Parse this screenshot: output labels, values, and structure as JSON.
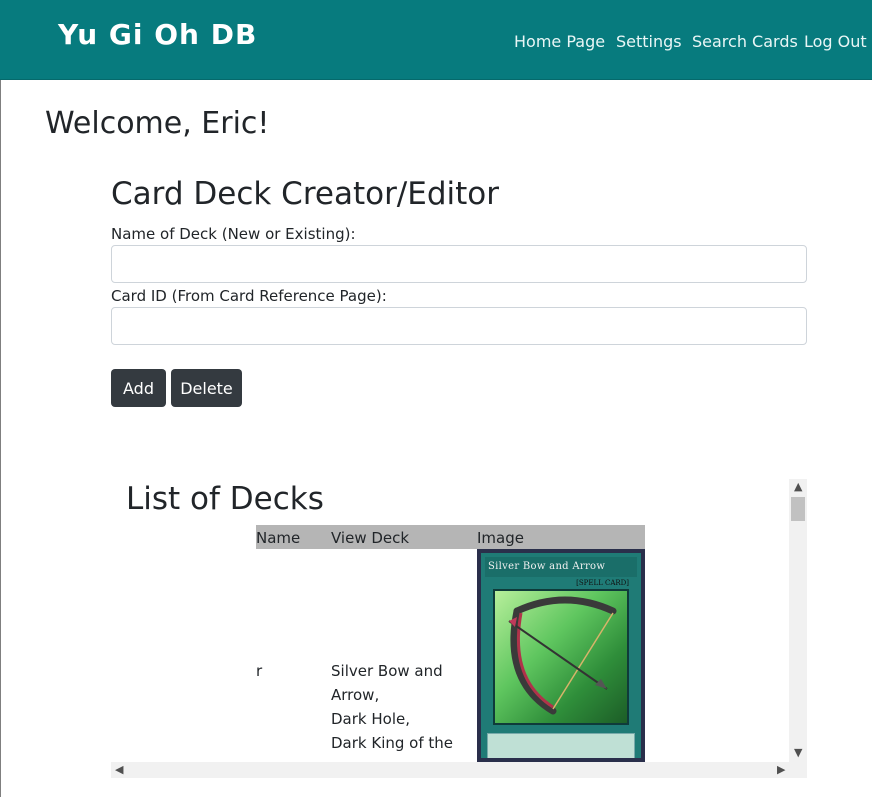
{
  "navbar": {
    "brand": "Yu Gi Oh DB",
    "links": [
      "Home Page",
      "Settings",
      "Search Cards",
      "Log Out"
    ]
  },
  "welcome": "Welcome, Eric!",
  "form": {
    "title": "Card Deck Creator/Editor",
    "deck_name_label": "Name of Deck (New or Existing):",
    "deck_name_value": "",
    "card_id_label": "Card ID (From Card Reference Page):",
    "card_id_value": "",
    "add_label": "Add",
    "delete_label": "Delete"
  },
  "decks": {
    "title": "List of Decks",
    "columns": [
      "Name",
      "View Deck",
      "Image"
    ],
    "rows": [
      {
        "name": "r",
        "cards": [
          "Silver Bow and",
          "Arrow,",
          "Dark Hole,",
          "Dark King of the"
        ],
        "image": {
          "title": "Silver Bow and Arrow",
          "type_line": "[SPELL CARD]"
        }
      }
    ]
  },
  "colors": {
    "navbar": "#077b7e",
    "button": "#343a40",
    "table_header": "#b5b5b5"
  }
}
